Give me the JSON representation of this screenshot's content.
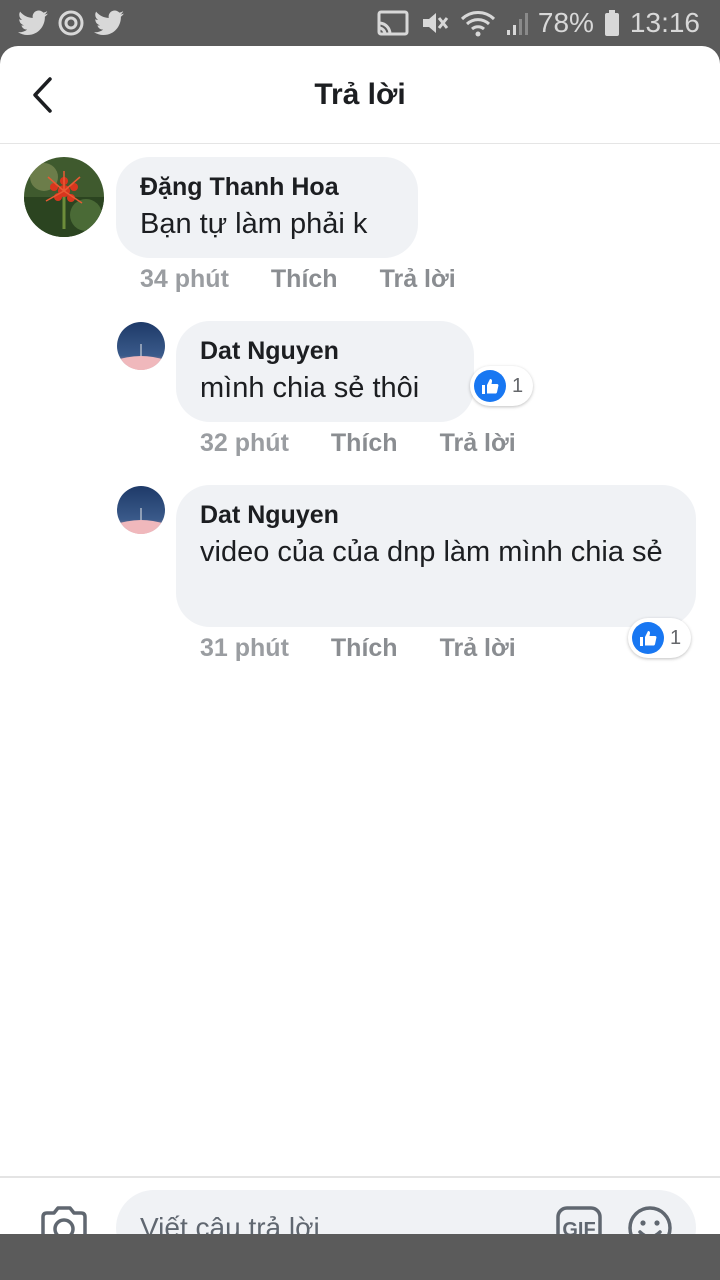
{
  "status_bar": {
    "battery": "78%",
    "time": "13:16",
    "left_icons": [
      "twitter-icon",
      "messenger-icon",
      "twitter-icon"
    ],
    "right_icons": [
      "cast-icon",
      "mute-icon",
      "wifi-icon",
      "signal-icon",
      "battery-icon"
    ]
  },
  "header": {
    "title": "Trả lời",
    "back_icon": "chevron-left-icon"
  },
  "comments": [
    {
      "author": "Đặng Thanh Hoa",
      "text": "Bạn tự làm phải k",
      "time": "34 phút",
      "like_label": "Thích",
      "reply_label": "Trả lời"
    },
    {
      "author": "Dat Nguyen",
      "text": "mình chia sẻ thôi",
      "time": "32 phút",
      "like_label": "Thích",
      "reply_label": "Trả lời",
      "reaction_count": "1"
    },
    {
      "author": "Dat Nguyen",
      "text": "video của của dnp làm mình chia sẻ",
      "time": "31 phút",
      "like_label": "Thích",
      "reply_label": "Trả lời",
      "reaction_count": "1"
    }
  ],
  "composer": {
    "placeholder": "Viết câu trả lời...",
    "gif_label": "GIF",
    "camera_icon": "camera-icon",
    "emoji_icon": "emoji-icon"
  },
  "colors": {
    "accent": "#1877f2",
    "bubble": "#f0f2f5",
    "meta_text": "#8a8d91",
    "status_bar": "#5b5b5b"
  }
}
